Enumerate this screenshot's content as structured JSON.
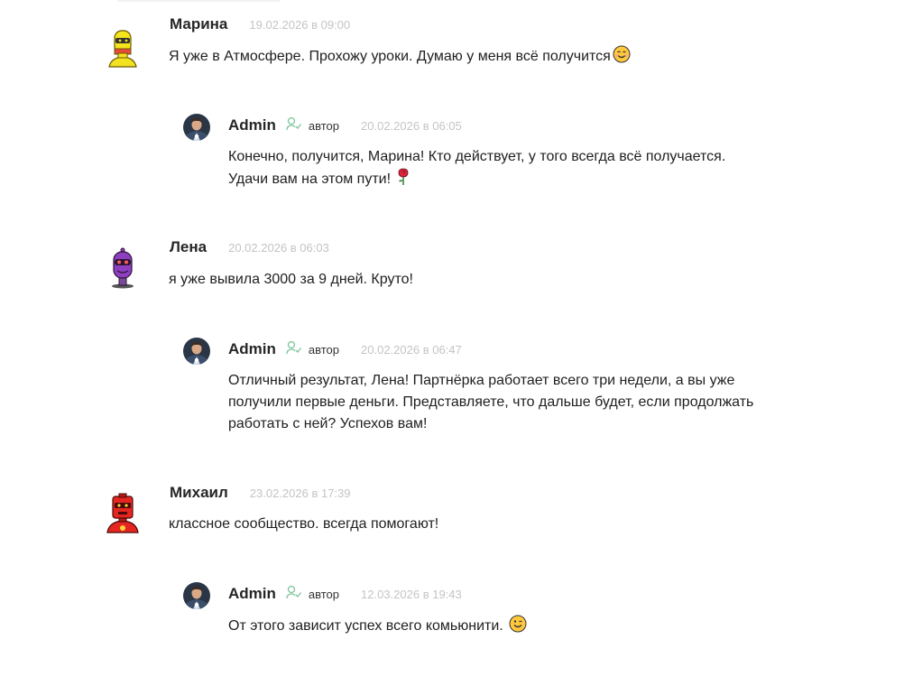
{
  "comments": [
    {
      "author": "Марина",
      "date": "19.02.2026 в 09:00",
      "avatar_icon": "yellow-robot-avatar",
      "text_line1": "Я уже в Атмосфере. Прохожу уроки. Думаю у меня всё получится",
      "emoji_icon": "smiling-face-emoji",
      "reply": {
        "author": "Admin",
        "role": "автор",
        "role_icon": "user-check-icon",
        "date": "20.02.2026 в 06:05",
        "text_line1": "Конечно, получится, Марина! Кто действует, у того всегда всё получается.",
        "text_line2": "Удачи вам на этом пути!",
        "emoji_icon": "rose-emoji"
      }
    },
    {
      "author": "Лена",
      "date": "20.02.2026 в 06:03",
      "avatar_icon": "purple-robot-avatar",
      "text_line1": "я уже вывила 3000 за 9 дней. Круто!",
      "reply": {
        "author": "Admin",
        "role": "автор",
        "role_icon": "user-check-icon",
        "date": "20.02.2026 в 06:47",
        "text_line1": "Отличный результат, Лена! Партнёрка работает всего три недели, а вы уже",
        "text_line2": "получили первые деньги. Представляете, что дальше будет, если продолжать",
        "text_line3": "работать с ней? Успехов вам!"
      }
    },
    {
      "author": "Михаил",
      "date": "23.02.2026 в 17:39",
      "avatar_icon": "red-robot-avatar",
      "text_line1": "классное сообщество. всегда помогают!",
      "reply": {
        "author": "Admin",
        "role": "автор",
        "role_icon": "user-check-icon",
        "date": "12.03.2026 в 19:43",
        "text_line1": "От этого зависит успех всего комьюнити.",
        "emoji_icon": "winking-face-emoji"
      }
    }
  ],
  "colors": {
    "role_icon": "#7cc49a",
    "date_text": "#c4c4c4",
    "author_text": "#262626"
  }
}
